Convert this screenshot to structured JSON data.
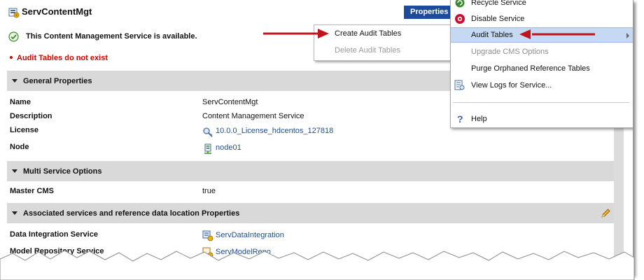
{
  "header": {
    "title": "ServContentMgt",
    "properties_button": "Properties"
  },
  "status": {
    "available_message": "This Content Management Service is available.",
    "error_message": "Audit Tables do not exist"
  },
  "sections": {
    "general": {
      "label": "General Properties",
      "rows": [
        {
          "key": "Name",
          "value": "ServContentMgt"
        },
        {
          "key": "Description",
          "value": "Content Management Service"
        },
        {
          "key": "License",
          "value": "10.0.0_License_hdcentos_127818"
        },
        {
          "key": "Node",
          "value": "node01"
        }
      ]
    },
    "multi": {
      "label": "Multi Service Options",
      "rows": [
        {
          "key": "Master CMS",
          "value": "true"
        }
      ]
    },
    "associated": {
      "label": "Associated services and reference data location Properties",
      "rows": [
        {
          "key": "Data Integration Service",
          "value": "ServDataIntegration"
        },
        {
          "key": "Model Repository Service",
          "value": "ServModelRepo"
        }
      ]
    }
  },
  "actions_menu": {
    "items": [
      {
        "label": "Recycle Service",
        "icon": "recycle-icon"
      },
      {
        "label": "Disable Service",
        "icon": "disable-icon"
      },
      {
        "label": "Audit Tables",
        "icon": "none",
        "selected": true
      },
      {
        "label": "Upgrade CMS Options",
        "icon": "none",
        "disabled": true
      },
      {
        "label": "Purge Orphaned Reference Tables",
        "icon": "none"
      },
      {
        "label": "View Logs for Service...",
        "icon": "view-logs-icon"
      },
      {
        "label": "Help",
        "icon": "help-icon"
      }
    ]
  },
  "audit_submenu": {
    "items": [
      {
        "label": "Create Audit Tables",
        "disabled": false
      },
      {
        "label": "Delete Audit Tables",
        "disabled": true
      }
    ]
  },
  "colors": {
    "button_bg": "#1e4a9a",
    "error_text": "#d10000",
    "link_text": "#1f4e8c",
    "section_bg": "#d9d9d9",
    "menu_selected": "#c5daf2",
    "annotation_arrow": "#c0141c"
  }
}
